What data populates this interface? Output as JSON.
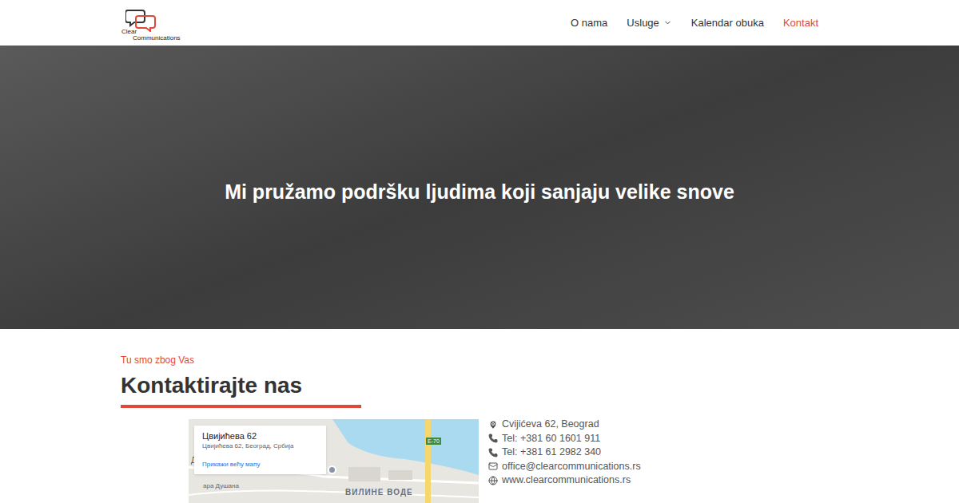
{
  "header": {
    "logo": [
      "Clear",
      "Communications"
    ],
    "nav": [
      {
        "label": "O nama",
        "selected": false,
        "dropdown": false
      },
      {
        "label": "Usluge",
        "selected": false,
        "dropdown": true
      },
      {
        "label": "Kalendar obuka",
        "selected": false,
        "dropdown": false
      },
      {
        "label": "Kontakt",
        "selected": true,
        "dropdown": false
      }
    ]
  },
  "hero": {
    "title": "Mi pružamo podršku ljudima koji sanjaju velike snove"
  },
  "contact": {
    "eyebrow": "Tu smo zbog Vas",
    "title": "Kontaktirajte nas",
    "map": {
      "place": "Цвијићева 62",
      "address": "Цвијићева 62, Београд, Србија",
      "link": "Прикажи већу мапу",
      "road": "E-70",
      "district": "ВИЛИНЕ ВОДЕ",
      "street": "ара Душана",
      "edge": "Д"
    },
    "items": [
      {
        "kind": "address",
        "text": "Cvijićeva 62, Beograd"
      },
      {
        "kind": "phone",
        "text": "Tel: +381 60 1601 911"
      },
      {
        "kind": "phone",
        "text": "Tel: +381 61 2982 340"
      },
      {
        "kind": "email",
        "text": "office@clearcommunications.rs"
      },
      {
        "kind": "web",
        "text": "www.clearcommunications.rs"
      }
    ]
  }
}
